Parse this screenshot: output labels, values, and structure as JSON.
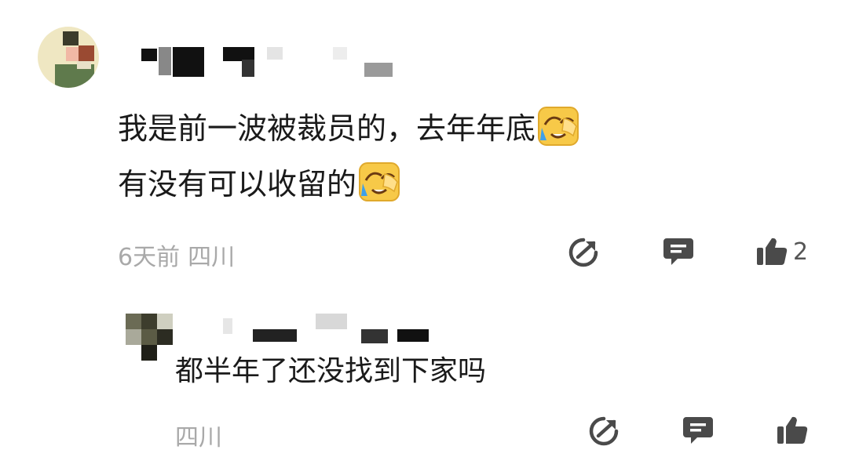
{
  "comment": {
    "line1": "我是前一波被裁员的，去年年底",
    "line2": "有没有可以收留的",
    "emoji": "facepalm-crying-emoji",
    "time": "6天前",
    "location": "四川",
    "like_count": "2"
  },
  "reply": {
    "text": "都半年了还没找到下家吗",
    "location": "四川"
  },
  "colors": {
    "text": "#1a1a1a",
    "meta": "#a9a9a9",
    "icon": "#4a4a4a",
    "emoji": "#f7c948"
  }
}
